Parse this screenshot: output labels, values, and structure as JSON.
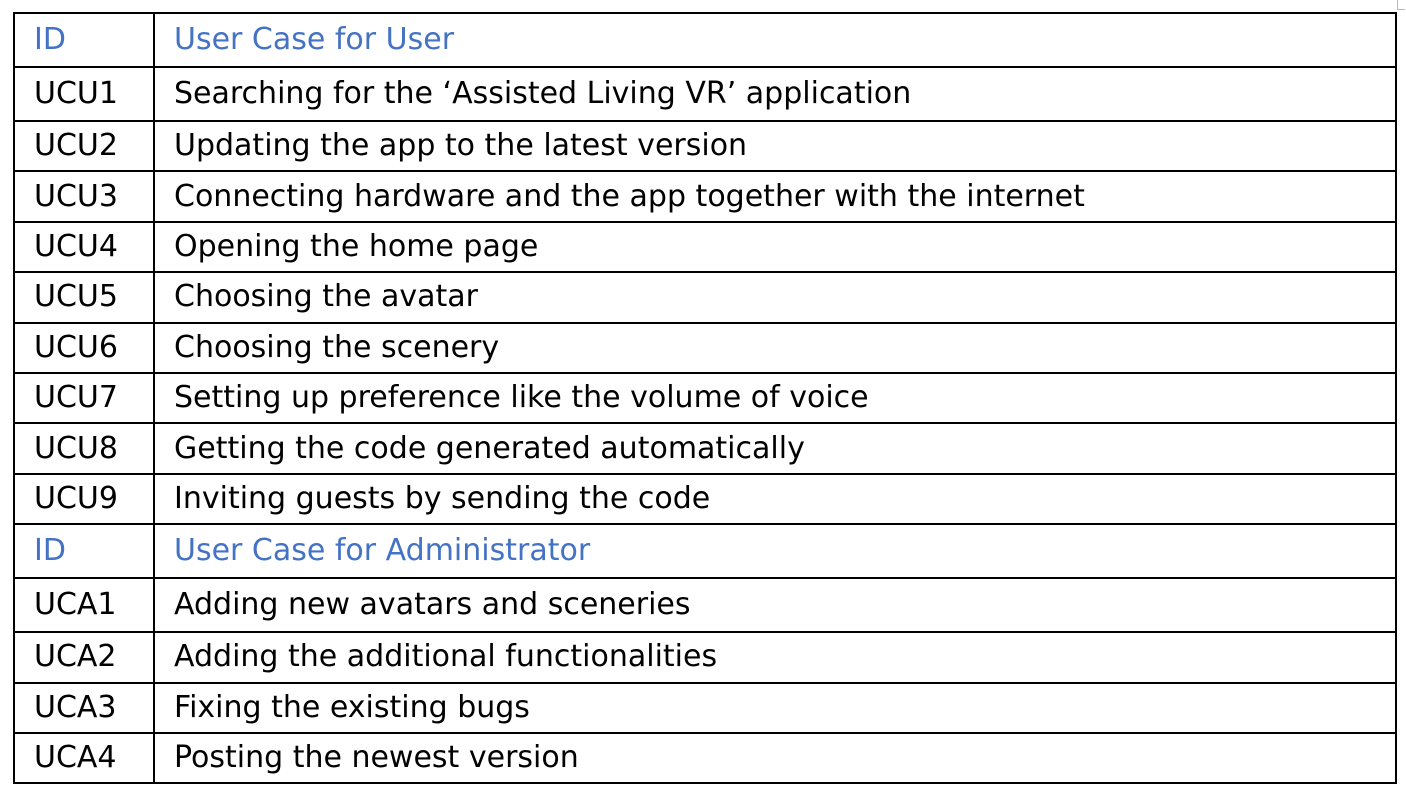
{
  "colors": {
    "header_text": "#4472c4",
    "body_text": "#000000",
    "border": "#000000"
  },
  "user_section": {
    "header": {
      "id": "ID",
      "title": "User Case for User"
    },
    "rows": [
      {
        "id": "UCU1",
        "text": "Searching for the ‘Assisted Living VR’ application"
      },
      {
        "id": "UCU2",
        "text": "Updating the app to the latest version"
      },
      {
        "id": "UCU3",
        "text": "Connecting hardware and the app together with the internet"
      },
      {
        "id": "UCU4",
        "text": "Opening the home page"
      },
      {
        "id": "UCU5",
        "text": "Choosing the avatar"
      },
      {
        "id": "UCU6",
        "text": "Choosing the scenery"
      },
      {
        "id": "UCU7",
        "text": "Setting up preference like the volume of voice"
      },
      {
        "id": "UCU8",
        "text": "Getting the code generated automatically"
      },
      {
        "id": "UCU9",
        "text": "Inviting guests by sending the code"
      }
    ]
  },
  "admin_section": {
    "header": {
      "id": "ID",
      "title": "User Case for Administrator"
    },
    "rows": [
      {
        "id": "UCA1",
        "text": "Adding new avatars and sceneries"
      },
      {
        "id": "UCA2",
        "text": "Adding the additional functionalities"
      },
      {
        "id": "UCA3",
        "text": "Fixing the existing bugs"
      },
      {
        "id": "UCA4",
        "text": "Posting the newest version"
      }
    ]
  }
}
